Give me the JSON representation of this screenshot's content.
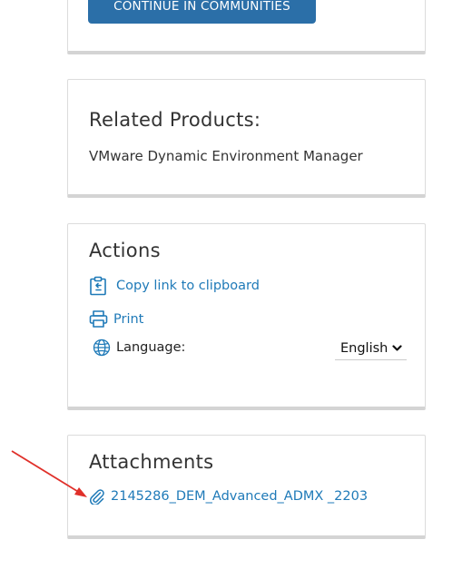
{
  "top_card": {
    "button_label": "CONTINUE IN COMMUNITIES"
  },
  "related": {
    "title": "Related Products:",
    "product": "VMware Dynamic Environment Manager"
  },
  "actions": {
    "title": "Actions",
    "copy_link_label": "Copy link to clipboard",
    "print_label": "Print",
    "language_label": "Language:",
    "language_value": "English"
  },
  "attachments": {
    "title": "Attachments",
    "file_name": "2145286_DEM_Advanced_ADMX _2203"
  },
  "colors": {
    "button_bg": "#2b6fa8",
    "link": "#1f7ab8",
    "annotation_arrow": "#e0302a"
  },
  "icons": {
    "copy": "clipboard-copy-icon",
    "print": "printer-icon",
    "language": "globe-icon",
    "dropdown": "chevron-down-icon",
    "attachment": "paperclip-icon"
  }
}
